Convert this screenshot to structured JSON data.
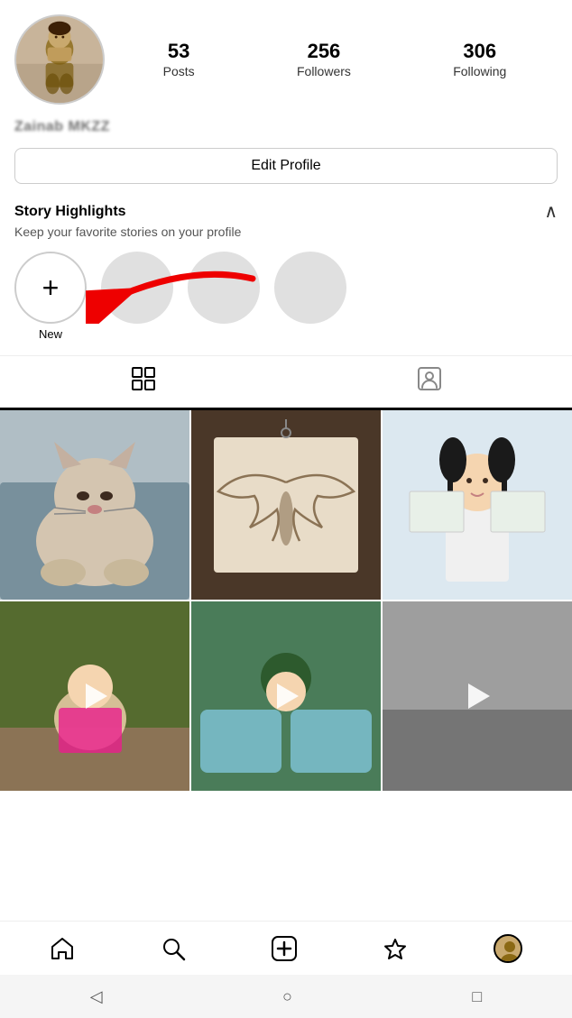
{
  "profile": {
    "avatar_alt": "Profile photo",
    "stats": {
      "posts_count": "53",
      "posts_label": "Posts",
      "followers_count": "256",
      "followers_label": "Followers",
      "following_count": "306",
      "following_label": "Following"
    },
    "username": "Zainab MKZZ",
    "edit_profile_label": "Edit Profile"
  },
  "story_highlights": {
    "title": "Story Highlights",
    "subtitle": "Keep your favorite stories on your profile",
    "chevron": "∧",
    "new_label": "New"
  },
  "tabs": {
    "grid_label": "Grid",
    "tagged_label": "Tagged"
  },
  "bottom_nav": {
    "home_label": "Home",
    "search_label": "Search",
    "add_label": "Add",
    "activity_label": "Activity",
    "profile_label": "Profile"
  },
  "android_nav": {
    "back_label": "◁",
    "home_label": "○",
    "recent_label": "□"
  }
}
